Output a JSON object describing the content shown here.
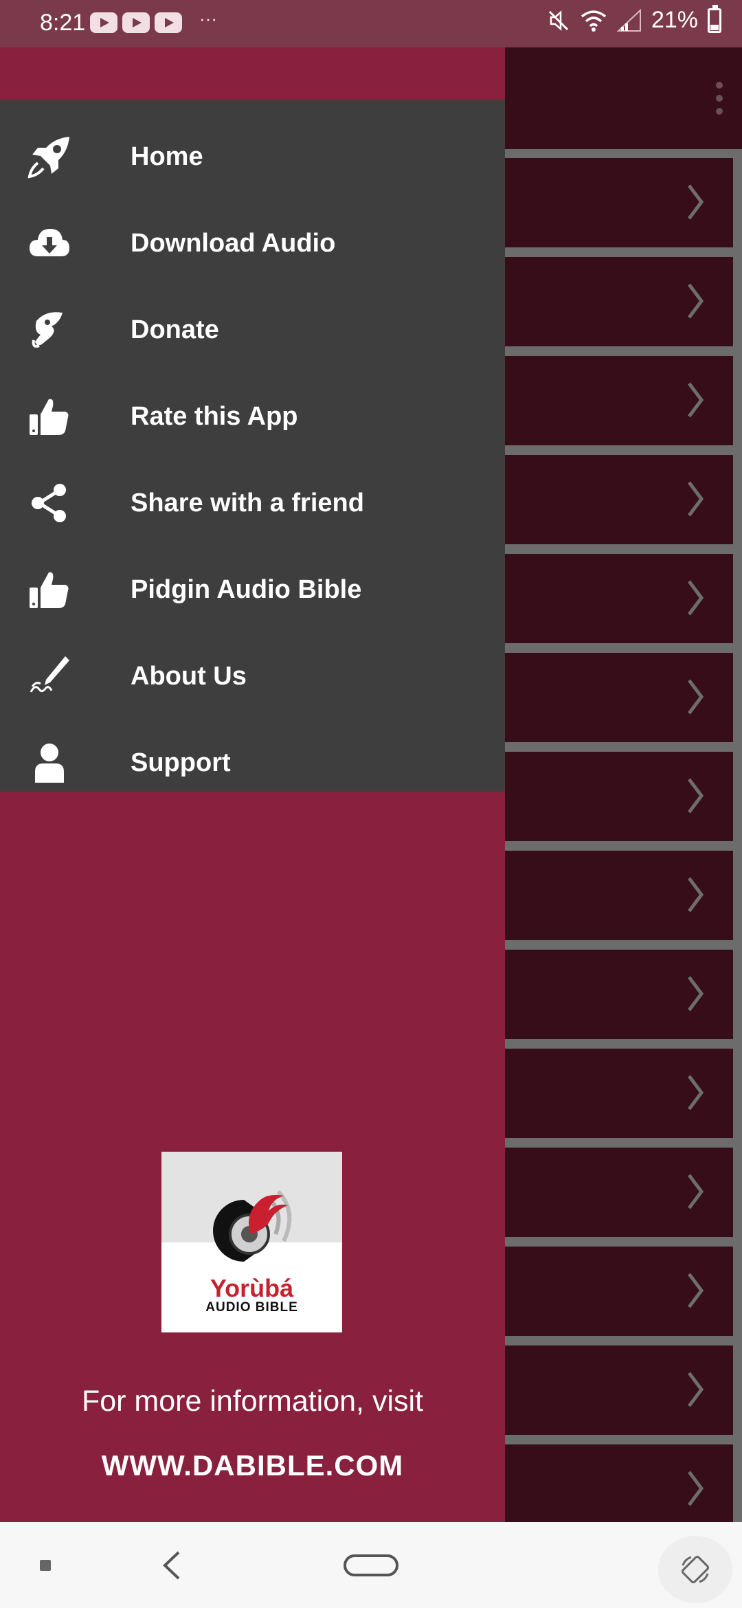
{
  "status_bar": {
    "time": "8:21",
    "more_indicator": "···",
    "battery": "21%",
    "icons": [
      "youtube-notification-icon",
      "youtube-notification-icon",
      "youtube-notification-icon",
      "mute-icon",
      "wifi-icon",
      "signal-icon",
      "battery-icon"
    ]
  },
  "drawer": {
    "menu_items": [
      {
        "label": "Home",
        "icon": "rocket-icon"
      },
      {
        "label": "Download Audio",
        "icon": "cloud-download-icon"
      },
      {
        "label": "Donate",
        "icon": "donate-hand-icon"
      },
      {
        "label": "Rate this App",
        "icon": "thumbs-up-icon"
      },
      {
        "label": "Share with a friend",
        "icon": "share-icon"
      },
      {
        "label": "Pidgin Audio Bible",
        "icon": "thumbs-up-icon"
      },
      {
        "label": "About Us",
        "icon": "signature-pen-icon"
      },
      {
        "label": "Support",
        "icon": "person-icon"
      }
    ],
    "logo": {
      "title": "Yorùbá",
      "subtitle": "AUDIO BIBLE"
    },
    "info_text": "For more information, visit",
    "info_url": "WWW.DABIBLE.COM"
  },
  "main": {
    "row_count": 14
  },
  "colors": {
    "drawer_bg": "#89203d",
    "menu_bg": "#3e3e3e",
    "list_row_bg": "#360d18",
    "status_bar_bg": "#7b3a4c"
  }
}
